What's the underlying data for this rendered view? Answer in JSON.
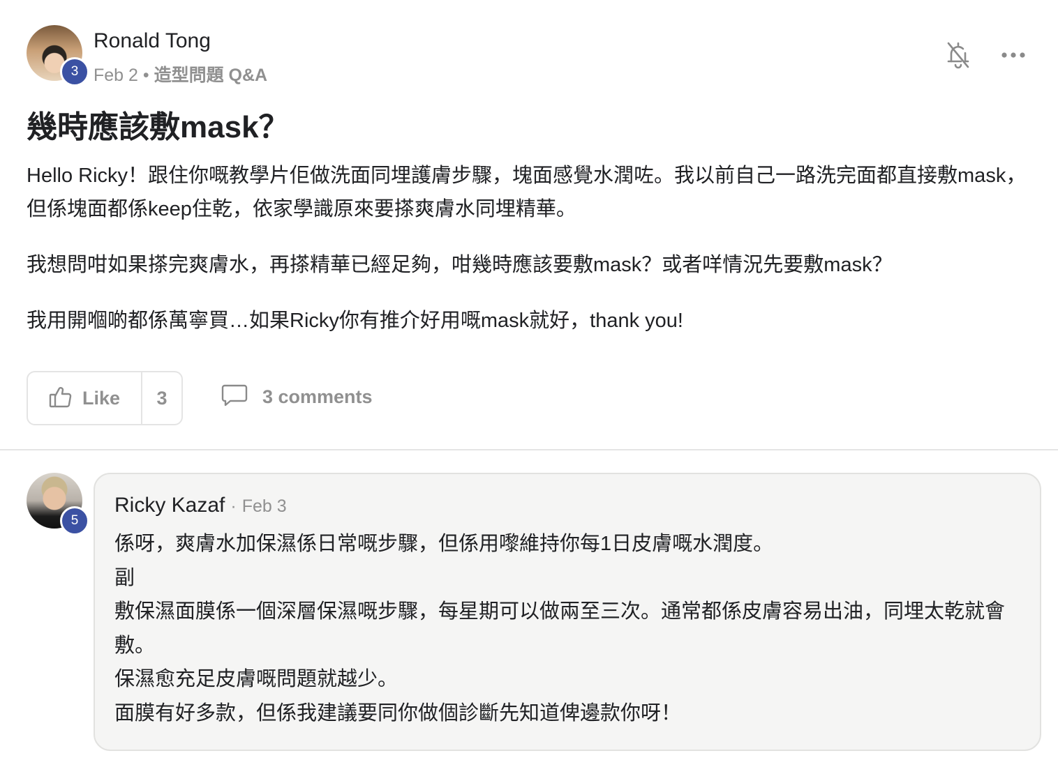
{
  "post": {
    "author": {
      "name": "Ronald Tong",
      "level": "3"
    },
    "date": "Feb 2",
    "separator": "•",
    "category": "造型問題 Q&A",
    "title": "幾時應該敷mask？",
    "paragraphs": [
      "Hello Ricky！跟住你嘅教學片佢做洗面同埋護膚步驟，塊面感覺水潤咗。我以前自己一路洗完面都直接敷mask，但係塊面都係keep住乾，依家學識原來要搽爽膚水同埋精華。",
      "我想問咁如果搽完爽膚水，再搽精華已經足夠，咁幾時應該要敷mask？或者咩情況先要敷mask？",
      "我用開嗰啲都係萬寧買…如果Ricky你有推介好用嘅mask就好，thank you!"
    ],
    "like_label": "Like",
    "like_count": "3",
    "comments_label": "3 comments",
    "icons": {
      "bell": "bell-off-icon",
      "more": "more-horizontal-icon",
      "like": "thumbs-up-icon",
      "comment": "comment-icon"
    }
  },
  "comment": {
    "author": {
      "name": "Ricky Kazaf",
      "level": "5"
    },
    "separator": "·",
    "date": "Feb 3",
    "lines": [
      "係呀，爽膚水加保濕係日常嘅步驟，但係用嚟維持你每1日皮膚嘅水潤度。",
      "副",
      "敷保濕面膜係一個深層保濕嘅步驟，每星期可以做兩至三次。通常都係皮膚容易出油，同埋太乾就會敷。",
      "保濕愈充足皮膚嘅問題就越少。",
      "面膜有好多款，但係我建議要同你做個診斷先知道俾邊款你呀！"
    ]
  },
  "colors": {
    "badge": "#3b51a3",
    "muted": "#909090",
    "text": "#202124",
    "bubble": "#f5f5f4",
    "border": "#e4e4e4"
  }
}
